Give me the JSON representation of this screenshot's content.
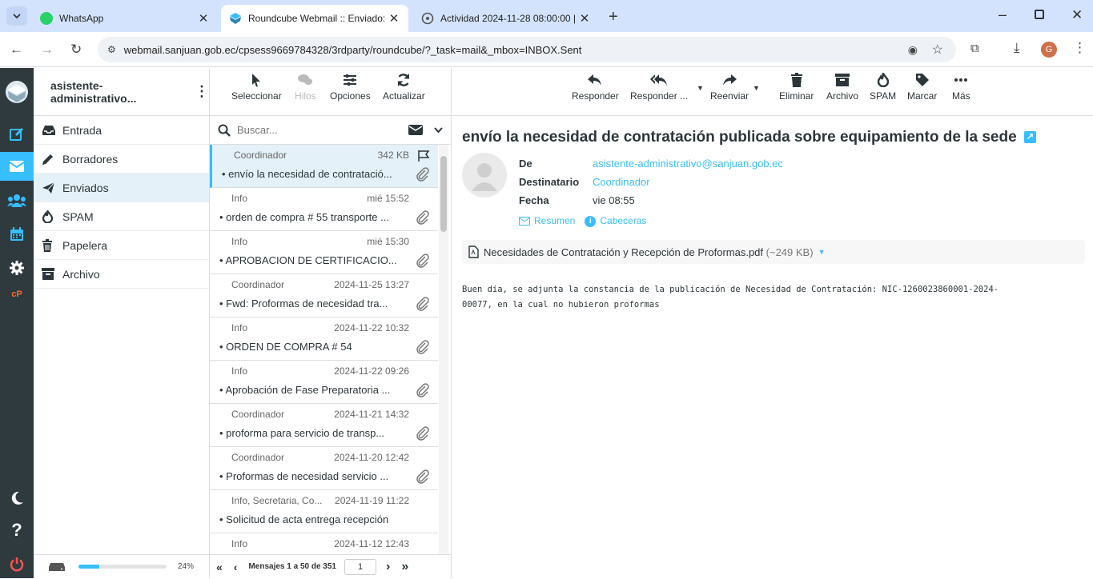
{
  "browser": {
    "tabs": [
      {
        "title": "WhatsApp",
        "icon": "whatsapp-icon",
        "color": "#25d366"
      },
      {
        "title": "Roundcube Webmail :: Enviado:",
        "icon": "roundcube-icon",
        "color": "#37beff"
      },
      {
        "title": "Actividad 2024-11-28 08:00:00 |",
        "icon": "globe-icon",
        "color": "#555555"
      }
    ],
    "url": "webmail.sanjuan.gob.ec/cpsess9669784328/3rdparty/roundcube/?_task=mail&_mbox=INBOX.Sent",
    "profile_initial": "G"
  },
  "sidebar": {
    "account": "asistente-administrativo...",
    "folders": [
      {
        "label": "Entrada",
        "icon": "inbox-icon"
      },
      {
        "label": "Borradores",
        "icon": "pencil-icon"
      },
      {
        "label": "Enviados",
        "icon": "paper-plane-icon"
      },
      {
        "label": "SPAM",
        "icon": "fire-icon"
      },
      {
        "label": "Papelera",
        "icon": "trash-icon"
      },
      {
        "label": "Archivo",
        "icon": "archive-icon"
      }
    ],
    "quota": "24%",
    "quota_fraction": 0.24
  },
  "list_toolbar": {
    "select": "Seleccionar",
    "threads": "Hilos",
    "options": "Opciones",
    "refresh": "Actualizar"
  },
  "search": {
    "placeholder": "Buscar..."
  },
  "messages": [
    {
      "from": "Coordinador",
      "date": "342 KB",
      "subject": "envío la necesidad de contratació...",
      "attach": true,
      "selected": true
    },
    {
      "from": "Info",
      "date": "mié 15:52",
      "subject": "orden de compra # 55 transporte ...",
      "attach": true
    },
    {
      "from": "Info",
      "date": "mié 15:30",
      "subject": "APROBACION DE CERTIFICACIO...",
      "attach": true
    },
    {
      "from": "Coordinador",
      "date": "2024-11-25 13:27",
      "subject": "Fwd: Proformas de necesidad tra...",
      "attach": true
    },
    {
      "from": "Info",
      "date": "2024-11-22 10:32",
      "subject": "ORDEN DE COMPRA # 54",
      "attach": true
    },
    {
      "from": "Info",
      "date": "2024-11-22 09:26",
      "subject": "Aprobación de Fase Preparatoria ...",
      "attach": true
    },
    {
      "from": "Coordinador",
      "date": "2024-11-21 14:32",
      "subject": "proforma para servicio de transp...",
      "attach": true
    },
    {
      "from": "Coordinador",
      "date": "2024-11-20 12:42",
      "subject": "Proformas de necesidad servicio ...",
      "attach": true
    },
    {
      "from": "Info, Secretaria, Co...",
      "date": "2024-11-19 11:22",
      "subject": "Solicitud de acta entrega recepción",
      "attach": false
    },
    {
      "from": "Info",
      "date": "2024-11-12 12:43",
      "subject": "",
      "attach": false
    }
  ],
  "pager": {
    "label": "Mensajes 1 a 50 de 351",
    "page": "1"
  },
  "mail_toolbar": {
    "reply": "Responder",
    "reply_all": "Responder ...",
    "forward": "Reenviar",
    "delete": "Eliminar",
    "archive": "Archivo",
    "spam": "SPAM",
    "mark": "Marcar",
    "more": "Más"
  },
  "mail": {
    "subject": "envío la necesidad de contratación publicada sobre equipamiento de la sede",
    "from_label": "De",
    "from": "asistente-administrativo@sanjuan.gob.ec",
    "to_label": "Destinatario",
    "to": "Coordinador",
    "date_label": "Fecha",
    "date": "vie 08:55",
    "summary": "Resumen",
    "headers": "Cabeceras",
    "attachment": "Necesidades de Contratación y Recepción de Proformas.pdf",
    "attachment_size": "(~249 KB)",
    "body": "Buen día, se adjunta la constancia de la publicación de Necesidad de Contratación: NIC-1260023860001-2024-\n00077, en la cual no hubieron proformas"
  },
  "colors": {
    "accent": "#37beff",
    "rail": "#2f3a3f",
    "selected": "#e4f1f9",
    "logout": "#ff5552"
  }
}
